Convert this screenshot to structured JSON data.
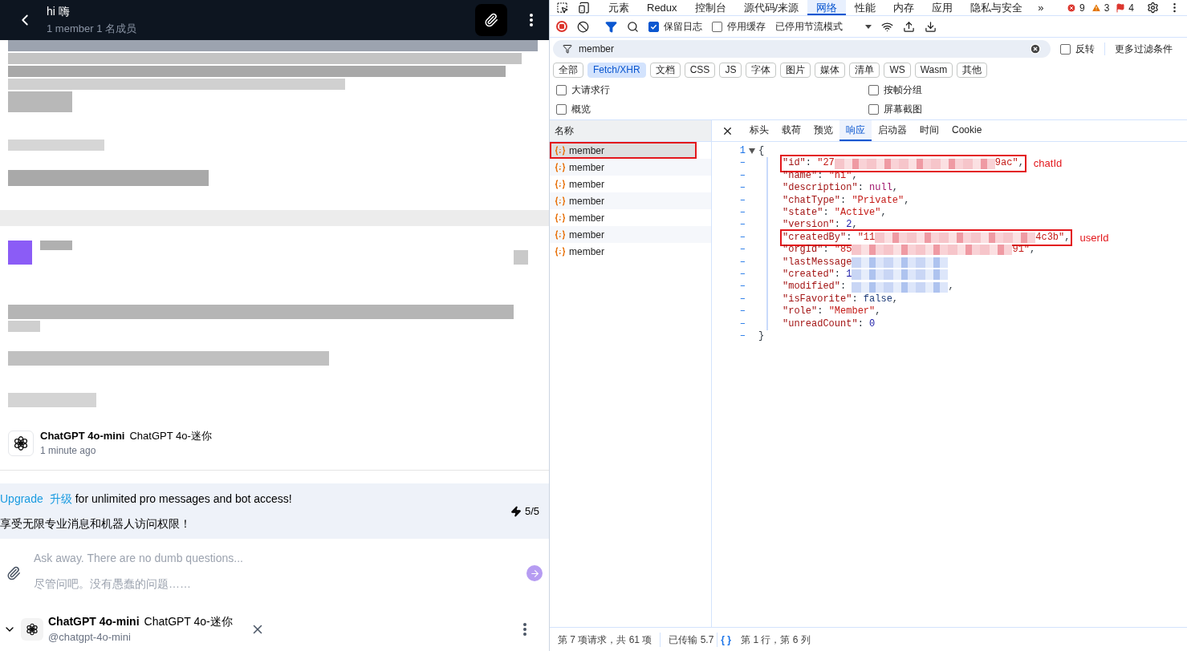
{
  "chat": {
    "header": {
      "title": "hi 嗨",
      "subtitle": "1 member 1 名成员"
    },
    "message_meta": {
      "bot_name": "ChatGPT 4o-mini",
      "bot_name_translation": "ChatGPT 4o-迷你",
      "time": "1 minute ago"
    },
    "upgrade_banner": {
      "link": "Upgrade",
      "link_translation": "升级",
      "text": "for unlimited pro messages and bot access!",
      "text_translation": "享受无限专业消息和机器人访问权限！",
      "quota": "5/5"
    },
    "composer": {
      "placeholder": "Ask away. There are no dumb questions...",
      "placeholder_translation": "尽管问吧。没有愚蠢的问题……"
    },
    "bot_bar": {
      "name": "ChatGPT 4o-mini",
      "name_translation": "ChatGPT 4o-迷你",
      "handle": "@chatgpt-4o-mini"
    }
  },
  "devtools": {
    "tabs": [
      {
        "label": "元素",
        "selected": false
      },
      {
        "label": "Redux",
        "selected": false
      },
      {
        "label": "控制台",
        "selected": false
      },
      {
        "label": "源代码/来源",
        "selected": false
      },
      {
        "label": "网络",
        "selected": true
      },
      {
        "label": "性能",
        "selected": false
      },
      {
        "label": "内存",
        "selected": false
      },
      {
        "label": "应用",
        "selected": false
      },
      {
        "label": "隐私与安全",
        "selected": false
      }
    ],
    "more_tabs": "»",
    "counts": {
      "errors": "9",
      "warnings": "3",
      "issues": "4"
    },
    "toolbar": {
      "preserve_log": {
        "label": "保留日志",
        "checked": true
      },
      "disable_cache": {
        "label": "停用缓存",
        "checked": false
      },
      "throttling": "已停用节流模式"
    },
    "filter": {
      "value": "member",
      "invert": {
        "label": "反转",
        "checked": false
      },
      "more_filters": "更多过滤条件"
    },
    "type_filters": [
      {
        "label": "全部",
        "selected": false
      },
      {
        "label": "Fetch/XHR",
        "selected": true
      },
      {
        "label": "文档",
        "selected": false
      },
      {
        "label": "CSS",
        "selected": false
      },
      {
        "label": "JS",
        "selected": false
      },
      {
        "label": "字体",
        "selected": false
      },
      {
        "label": "图片",
        "selected": false
      },
      {
        "label": "媒体",
        "selected": false
      },
      {
        "label": "清单",
        "selected": false
      },
      {
        "label": "WS",
        "selected": false
      },
      {
        "label": "Wasm",
        "selected": false
      },
      {
        "label": "其他",
        "selected": false
      }
    ],
    "options": [
      {
        "label": "大请求行",
        "checked": false
      },
      {
        "label": "按帧分组",
        "checked": false
      },
      {
        "label": "概览",
        "checked": false
      },
      {
        "label": "屏幕截图",
        "checked": false
      }
    ],
    "requests": {
      "column": "名称",
      "items": [
        {
          "name": "member",
          "selected": true,
          "highlighted": true
        },
        {
          "name": "member",
          "selected": false,
          "highlighted": false
        },
        {
          "name": "member",
          "selected": false,
          "highlighted": false
        },
        {
          "name": "member",
          "selected": false,
          "highlighted": false
        },
        {
          "name": "member",
          "selected": false,
          "highlighted": false
        },
        {
          "name": "member",
          "selected": false,
          "highlighted": false
        },
        {
          "name": "member",
          "selected": false,
          "highlighted": false
        }
      ]
    },
    "detail_tabs": [
      {
        "label": "标头",
        "selected": false
      },
      {
        "label": "载荷",
        "selected": false
      },
      {
        "label": "预览",
        "selected": false
      },
      {
        "label": "响应",
        "selected": true
      },
      {
        "label": "启动器",
        "selected": false
      },
      {
        "label": "时间",
        "selected": false
      },
      {
        "label": "Cookie",
        "selected": false
      }
    ],
    "response": [
      {
        "gutter": "1",
        "expanded": true,
        "segments": [
          {
            "kind": "punct",
            "text": "{"
          }
        ]
      },
      {
        "gutter": "–",
        "annotation": "chatId",
        "segments": [
          {
            "kind": "key",
            "text": "\"id\""
          },
          {
            "kind": "punct",
            "text": ": "
          },
          {
            "kind": "string",
            "text": "\"27"
          },
          {
            "kind": "redacted"
          },
          {
            "kind": "string",
            "text": "9ac\""
          },
          {
            "kind": "punct",
            "text": ","
          }
        ]
      },
      {
        "gutter": "–",
        "segments": [
          {
            "kind": "key",
            "text": "\"name\""
          },
          {
            "kind": "punct",
            "text": ": "
          },
          {
            "kind": "string",
            "text": "\"hi\""
          },
          {
            "kind": "punct",
            "text": ","
          }
        ]
      },
      {
        "gutter": "–",
        "segments": [
          {
            "kind": "key",
            "text": "\"description\""
          },
          {
            "kind": "punct",
            "text": ": "
          },
          {
            "kind": "null",
            "text": "null"
          },
          {
            "kind": "punct",
            "text": ","
          }
        ]
      },
      {
        "gutter": "–",
        "segments": [
          {
            "kind": "key",
            "text": "\"chatType\""
          },
          {
            "kind": "punct",
            "text": ": "
          },
          {
            "kind": "string",
            "text": "\"Private\""
          },
          {
            "kind": "punct",
            "text": ","
          }
        ]
      },
      {
        "gutter": "–",
        "segments": [
          {
            "kind": "key",
            "text": "\"state\""
          },
          {
            "kind": "punct",
            "text": ": "
          },
          {
            "kind": "string",
            "text": "\"Active\""
          },
          {
            "kind": "punct",
            "text": ","
          }
        ]
      },
      {
        "gutter": "–",
        "segments": [
          {
            "kind": "key",
            "text": "\"version\""
          },
          {
            "kind": "punct",
            "text": ": "
          },
          {
            "kind": "number",
            "text": "2"
          },
          {
            "kind": "punct",
            "text": ","
          }
        ]
      },
      {
        "gutter": "–",
        "annotation": "userId",
        "segments": [
          {
            "kind": "key",
            "text": "\"createdBy\""
          },
          {
            "kind": "punct",
            "text": ": "
          },
          {
            "kind": "string",
            "text": "\"11"
          },
          {
            "kind": "redacted"
          },
          {
            "kind": "string",
            "text": "4c3b\""
          },
          {
            "kind": "punct",
            "text": ","
          }
        ]
      },
      {
        "gutter": "–",
        "segments": [
          {
            "kind": "key",
            "text": "\"orgId\""
          },
          {
            "kind": "punct",
            "text": ": "
          },
          {
            "kind": "string",
            "text": "\"85"
          },
          {
            "kind": "redacted"
          },
          {
            "kind": "string",
            "text": "91\""
          },
          {
            "kind": "punct",
            "text": ","
          }
        ]
      },
      {
        "gutter": "–",
        "segments": [
          {
            "kind": "key",
            "text": "\"lastMessage"
          },
          {
            "kind": "masked"
          }
        ]
      },
      {
        "gutter": "–",
        "segments": [
          {
            "kind": "key",
            "text": "\"created\""
          },
          {
            "kind": "punct",
            "text": ": "
          },
          {
            "kind": "number",
            "text": "1"
          },
          {
            "kind": "masked"
          }
        ]
      },
      {
        "gutter": "–",
        "segments": [
          {
            "kind": "key",
            "text": "\"modified\""
          },
          {
            "kind": "punct",
            "text": ": "
          },
          {
            "kind": "masked"
          },
          {
            "kind": "punct",
            "text": ","
          }
        ]
      },
      {
        "gutter": "–",
        "segments": [
          {
            "kind": "key",
            "text": "\"isFavorite\""
          },
          {
            "kind": "punct",
            "text": ": "
          },
          {
            "kind": "bool",
            "text": "false"
          },
          {
            "kind": "punct",
            "text": ","
          }
        ]
      },
      {
        "gutter": "–",
        "segments": [
          {
            "kind": "key",
            "text": "\"role\""
          },
          {
            "kind": "punct",
            "text": ": "
          },
          {
            "kind": "string",
            "text": "\"Member\""
          },
          {
            "kind": "punct",
            "text": ","
          }
        ]
      },
      {
        "gutter": "–",
        "segments": [
          {
            "kind": "key",
            "text": "\"unreadCount\""
          },
          {
            "kind": "punct",
            "text": ": "
          },
          {
            "kind": "number",
            "text": "0"
          }
        ]
      },
      {
        "gutter": "–",
        "segments": [
          {
            "kind": "punct",
            "text": "}"
          }
        ]
      }
    ],
    "status_bar": {
      "requests": "第 7 项请求，共 61 项",
      "transferred": "已传输 5.7",
      "format_button": "{ }",
      "position": "第 1 行，第 6 列"
    }
  }
}
